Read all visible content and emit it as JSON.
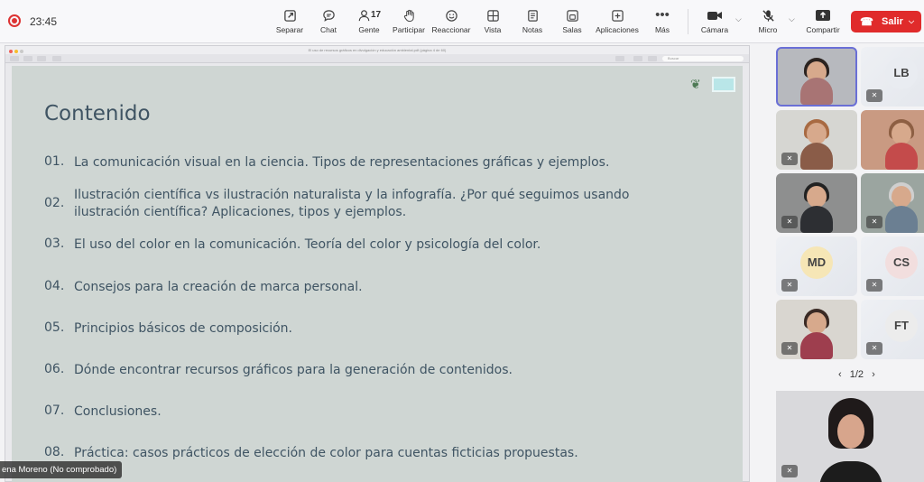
{
  "meeting": {
    "timer": "23:45",
    "toolbar": [
      {
        "label": "Separar",
        "icon": "pop-out-icon"
      },
      {
        "label": "Chat",
        "icon": "chat-icon"
      },
      {
        "label": "Gente",
        "icon": "people-icon",
        "count": "17"
      },
      {
        "label": "Participar",
        "icon": "raise-hand-icon"
      },
      {
        "label": "Reaccionar",
        "icon": "smiley-icon"
      },
      {
        "label": "Vista",
        "icon": "grid-icon"
      },
      {
        "label": "Notas",
        "icon": "notes-icon"
      },
      {
        "label": "Salas",
        "icon": "rooms-icon"
      },
      {
        "label": "Aplicaciones",
        "icon": "apps-plus-icon"
      },
      {
        "label": "Más",
        "icon": "more-icon"
      },
      {
        "label": "Cámara",
        "icon": "camera-icon"
      },
      {
        "label": "Micro",
        "icon": "mic-muted-icon"
      },
      {
        "label": "Compartir",
        "icon": "share-icon"
      }
    ],
    "leave_label": "Salir",
    "accent": "#e02b2b"
  },
  "screen_share": {
    "viewer_title": "El uso de recursos gráficos en divulgación y educación ambiental.pdf (página 4 de 60)",
    "search_placeholder": "Buscar",
    "presenter": "ena Moreno (No comprobado)",
    "slide": {
      "title": "Contenido",
      "items": [
        {
          "num": "01.",
          "text": "La comunicación visual en la ciencia. Tipos de representaciones gráficas y ejemplos."
        },
        {
          "num": "02.",
          "text": "Ilustración científica vs ilustración naturalista y la infografía. ¿Por qué seguimos usando ilustración científica? Aplicaciones, tipos y ejemplos."
        },
        {
          "num": "03.",
          "text": "El uso del color en la comunicación. Teoría del color y psicología del color."
        },
        {
          "num": "04.",
          "text": "Consejos para la creación de marca personal."
        },
        {
          "num": "05.",
          "text": "Principios básicos de composición."
        },
        {
          "num": "06.",
          "text": "Dónde encontrar recursos gráficos para la generación de contenidos."
        },
        {
          "num": "07.",
          "text": "Conclusiones."
        },
        {
          "num": "08.",
          "text": "Práctica: casos prácticos de elección de color para cuentas ficticias propuestas."
        }
      ],
      "colors": {
        "background": "#cfd6d3",
        "text": "#3f5463"
      }
    }
  },
  "gallery": {
    "participants": [
      {
        "type": "video",
        "muted": false,
        "active": true
      },
      {
        "type": "avatar",
        "initials": "LB",
        "muted": true
      },
      {
        "type": "video",
        "muted": true
      },
      {
        "type": "video",
        "muted": false
      },
      {
        "type": "video",
        "muted": true
      },
      {
        "type": "video",
        "muted": true
      },
      {
        "type": "avatar",
        "initials": "MD",
        "muted": true
      },
      {
        "type": "avatar",
        "initials": "CS",
        "muted": true
      },
      {
        "type": "video",
        "muted": true
      },
      {
        "type": "avatar",
        "initials": "FT",
        "muted": true
      }
    ],
    "pager": {
      "prev": "‹",
      "label": "1/2",
      "next": "›"
    },
    "self_view": {
      "muted": true
    }
  }
}
